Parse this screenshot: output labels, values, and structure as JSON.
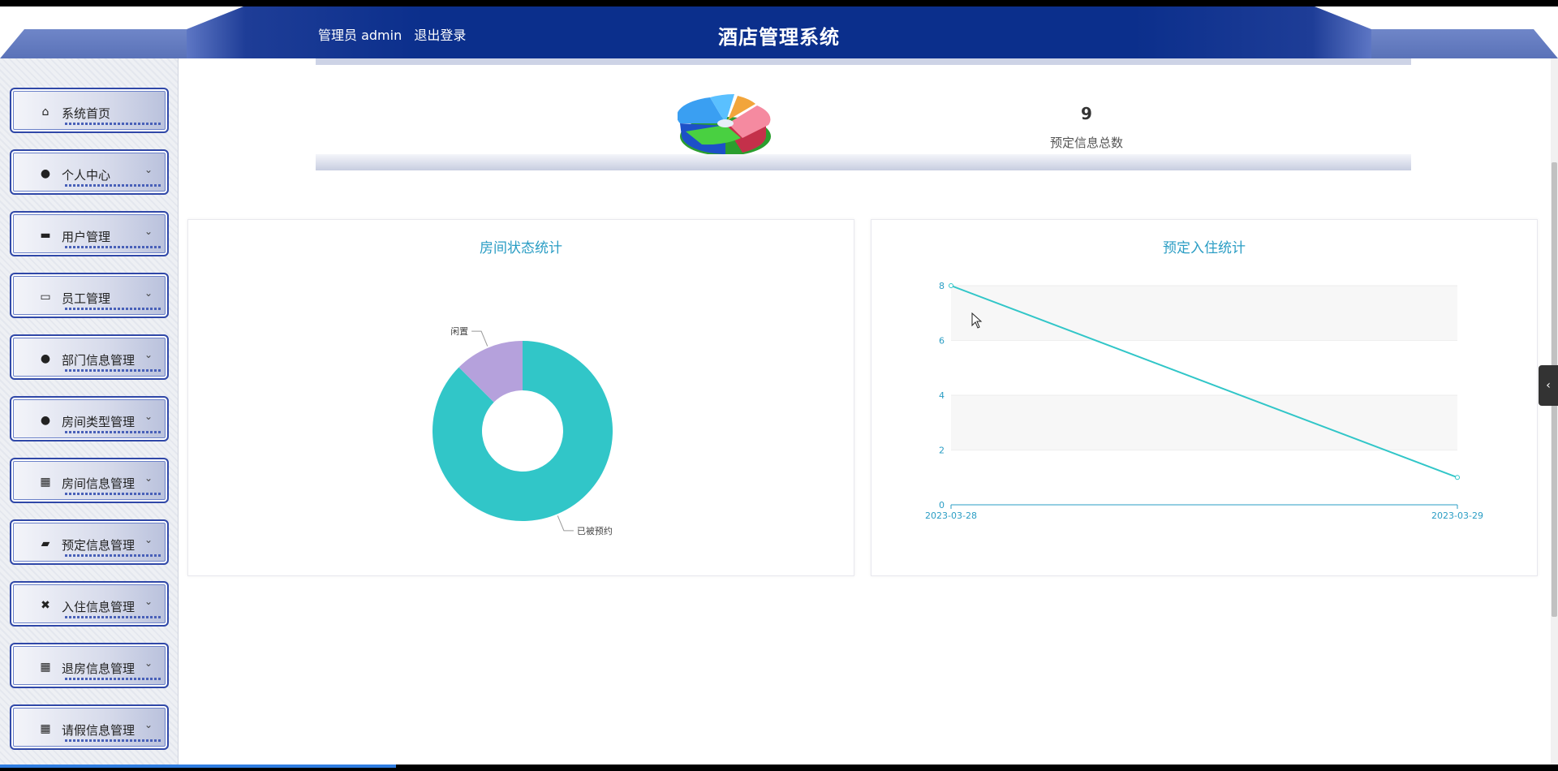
{
  "header": {
    "user_text": "管理员 admin",
    "logout_label": "退出登录",
    "title": "酒店管理系统"
  },
  "sidebar": {
    "items": [
      {
        "label": "系统首页",
        "icon": "home-icon",
        "has_arrow": false
      },
      {
        "label": "个人中心",
        "icon": "person-icon",
        "has_arrow": true
      },
      {
        "label": "用户管理",
        "icon": "seat-icon",
        "has_arrow": true
      },
      {
        "label": "员工管理",
        "icon": "monitor-icon",
        "has_arrow": true
      },
      {
        "label": "部门信息管理",
        "icon": "bulb-icon",
        "has_arrow": true
      },
      {
        "label": "房间类型管理",
        "icon": "person-icon",
        "has_arrow": true
      },
      {
        "label": "房间信息管理",
        "icon": "grid-icon",
        "has_arrow": true
      },
      {
        "label": "预定信息管理",
        "icon": "wallet-icon",
        "has_arrow": true
      },
      {
        "label": "入住信息管理",
        "icon": "ticket-icon",
        "has_arrow": true
      },
      {
        "label": "退房信息管理",
        "icon": "grid-icon",
        "has_arrow": true
      },
      {
        "label": "请假信息管理",
        "icon": "grid-icon",
        "has_arrow": true
      }
    ]
  },
  "stat": {
    "value": "9",
    "label": "预定信息总数"
  },
  "colors": {
    "header_dark": "#0b2f8c",
    "chart_teal": "#31c6c8",
    "chart_purple": "#b5a1dc",
    "title_blue": "#2a9dc4"
  },
  "chart_data": [
    {
      "type": "pie",
      "title": "房间状态统计",
      "donut": true,
      "slices": [
        {
          "name": "已被预约",
          "value": 7
        },
        {
          "name": "闲置",
          "value": 1
        }
      ]
    },
    {
      "type": "line",
      "title": "预定入住统计",
      "x": [
        "2023-03-28",
        "2023-03-29"
      ],
      "series": [
        {
          "values": [
            8,
            1
          ]
        }
      ],
      "ylim": [
        0,
        8
      ],
      "yticks": [
        "0",
        "2",
        "4",
        "6",
        "8"
      ],
      "grid": "horizontal-bands"
    }
  ]
}
